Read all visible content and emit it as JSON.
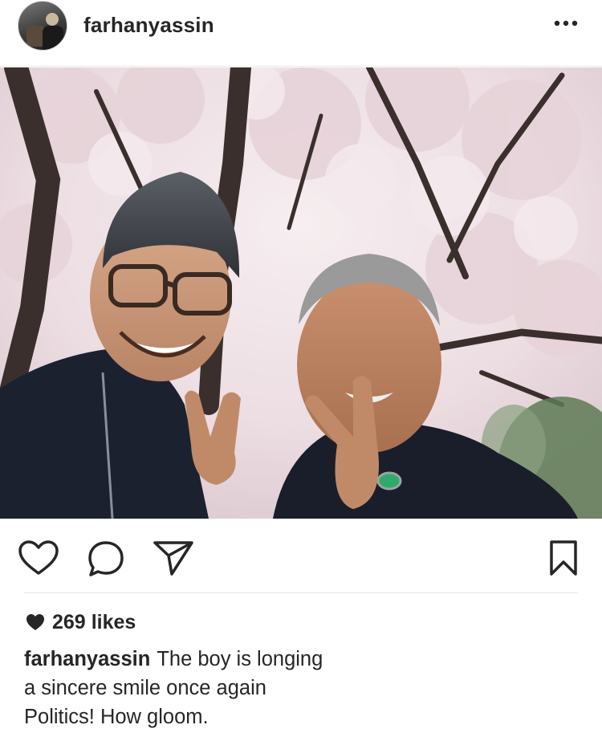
{
  "post": {
    "username": "farhanyassin",
    "more_icon": "ellipsis-horizontal-icon",
    "likes_count": "269",
    "likes_word": "likes",
    "caption": {
      "username": "farhanyassin",
      "lines": [
        "The boy is longing",
        "a sincere smile once again",
        "Politics! How gloom."
      ]
    }
  },
  "actions": {
    "like_icon": "heart-outline-icon",
    "comment_icon": "speech-bubble-icon",
    "share_icon": "paper-plane-icon",
    "save_icon": "bookmark-icon"
  },
  "colors": {
    "text": "#262626",
    "divider": "#e6e6e6",
    "background": "#ffffff"
  }
}
